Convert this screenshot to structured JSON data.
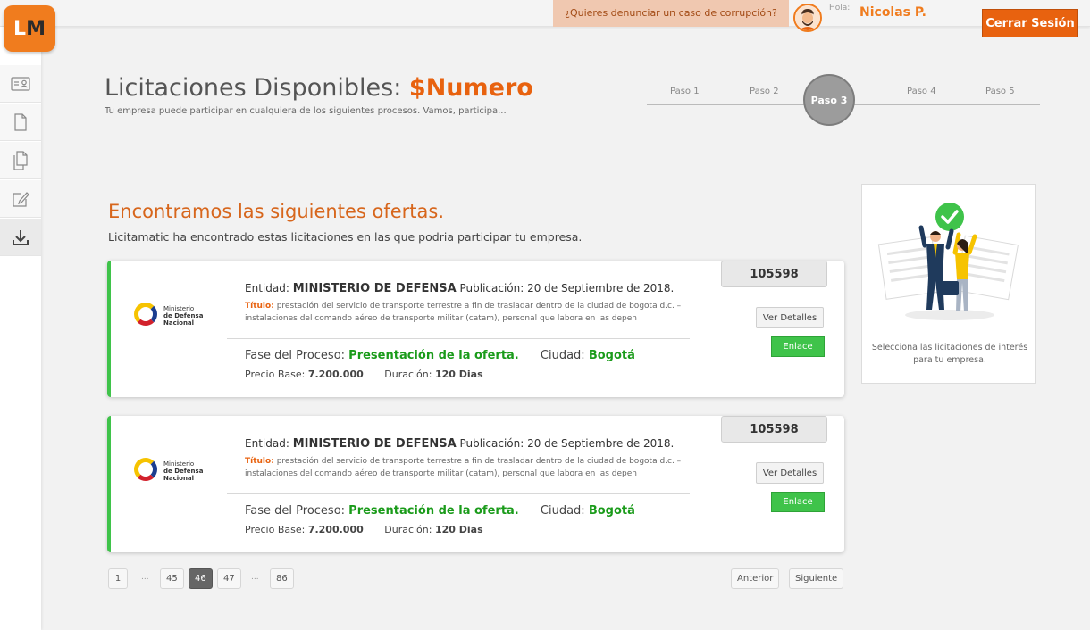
{
  "header": {
    "report_link": "¿Quieres denunciar un caso de corrupción?",
    "greeting": "Hola:",
    "user_name": "Nicolas P.",
    "logout_label": "Cerrar Sesión"
  },
  "logo": {
    "text_a": "L",
    "text_b": "M"
  },
  "sidebar": {
    "items": [
      {
        "icon": "id-card-icon"
      },
      {
        "icon": "document-icon"
      },
      {
        "icon": "copy-documents-icon"
      },
      {
        "icon": "edit-icon"
      },
      {
        "icon": "download-icon"
      }
    ]
  },
  "page": {
    "title": "Licitaciones Disponibles:",
    "title_number": "$Numero",
    "subtitle": "Tu empresa puede participar en cualquiera de los siguientes procesos. Vamos, participa..."
  },
  "steps": [
    {
      "label": "Paso 1",
      "active": false
    },
    {
      "label": "Paso 2",
      "active": false
    },
    {
      "label": "Paso 3",
      "active": true
    },
    {
      "label": "Paso 4",
      "active": false
    },
    {
      "label": "Paso 5",
      "active": false
    }
  ],
  "section": {
    "title": "Encontramos las siguientes ofertas.",
    "subtitle": "Licitamatic ha encontrado estas licitaciones en las que podria participar tu empresa."
  },
  "offers": [
    {
      "code": "105598",
      "logo_line1": "Ministerio",
      "logo_line2": "de Defensa",
      "logo_line3": "Nacional",
      "entidad_label": "Entidad:",
      "entidad": "MINISTERIO DE DEFENSA",
      "publicacion": "Publicación: 20 de Septiembre de 2018.",
      "titulo_label": "Título:",
      "titulo": "prestación del servicio de transporte terrestre a fin de trasladar dentro de la ciudad de bogota d.c. – instalaciones del comando aéreo de transporte militar (catam), personal que labora en las depen",
      "fase_label": "Fase del Proceso:",
      "fase": "Presentación de la oferta.",
      "ciudad_label": "Ciudad:",
      "ciudad": "Bogotá",
      "precio_label": "Precio Base:",
      "precio": "7.200.000",
      "duracion_label": "Duración:",
      "duracion": "120 Dias",
      "details_label": "Ver Detalles",
      "link_label": "Enlace"
    },
    {
      "code": "105598",
      "logo_line1": "Ministerio",
      "logo_line2": "de Defensa",
      "logo_line3": "Nacional",
      "entidad_label": "Entidad:",
      "entidad": "MINISTERIO DE DEFENSA",
      "publicacion": "Publicación: 20 de Septiembre de 2018.",
      "titulo_label": "Título:",
      "titulo": "prestación del servicio de transporte terrestre a fin de trasladar dentro de la ciudad de bogota d.c. – instalaciones del comando aéreo de transporte militar (catam), personal que labora en las depen",
      "fase_label": "Fase del Proceso:",
      "fase": "Presentación de la oferta.",
      "ciudad_label": "Ciudad:",
      "ciudad": "Bogotá",
      "precio_label": "Precio Base:",
      "precio": "7.200.000",
      "duracion_label": "Duración:",
      "duracion": "120 Dias",
      "details_label": "Ver Detalles",
      "link_label": "Enlace"
    }
  ],
  "panel": {
    "text": "Selecciona las licitaciones de interés para tu empresa."
  },
  "pagination": {
    "pages": [
      "1",
      "45",
      "46",
      "47",
      "86"
    ],
    "ellipsis": "...",
    "current": "46",
    "prev_label": "Anterior",
    "next_label": "Siguiente"
  },
  "colors": {
    "accent": "#e8620f",
    "success": "#3fc34a",
    "text_green": "#1a9b1a"
  }
}
